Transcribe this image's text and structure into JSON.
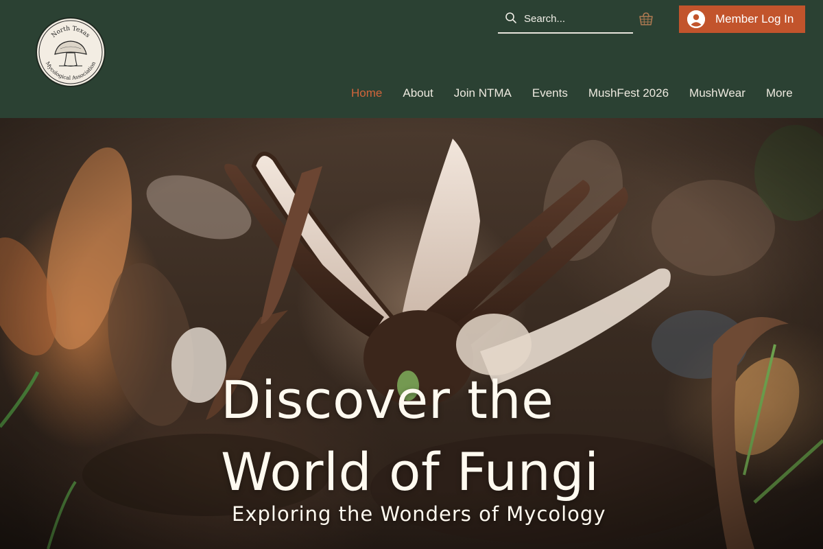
{
  "header": {
    "logo": {
      "top_text": "North Texas",
      "bottom_text": "Mycological Association"
    },
    "search": {
      "placeholder": "Search..."
    },
    "cart_icon": "cart-icon",
    "login": {
      "label": "Member Log In"
    },
    "nav": [
      {
        "label": "Home",
        "active": true
      },
      {
        "label": "About"
      },
      {
        "label": "Join NTMA"
      },
      {
        "label": "Events"
      },
      {
        "label": "MushFest 2026"
      },
      {
        "label": "MushWear"
      },
      {
        "label": "More"
      }
    ]
  },
  "hero": {
    "title_line1": "Discover the",
    "title_line2": "World of Fungi",
    "subtitle": "Exploring the Wonders of Mycology"
  },
  "colors": {
    "header_bg": "#2b4133",
    "accent": "#c2542c",
    "nav_active": "#d2653b",
    "text_light": "#fffaf0"
  }
}
